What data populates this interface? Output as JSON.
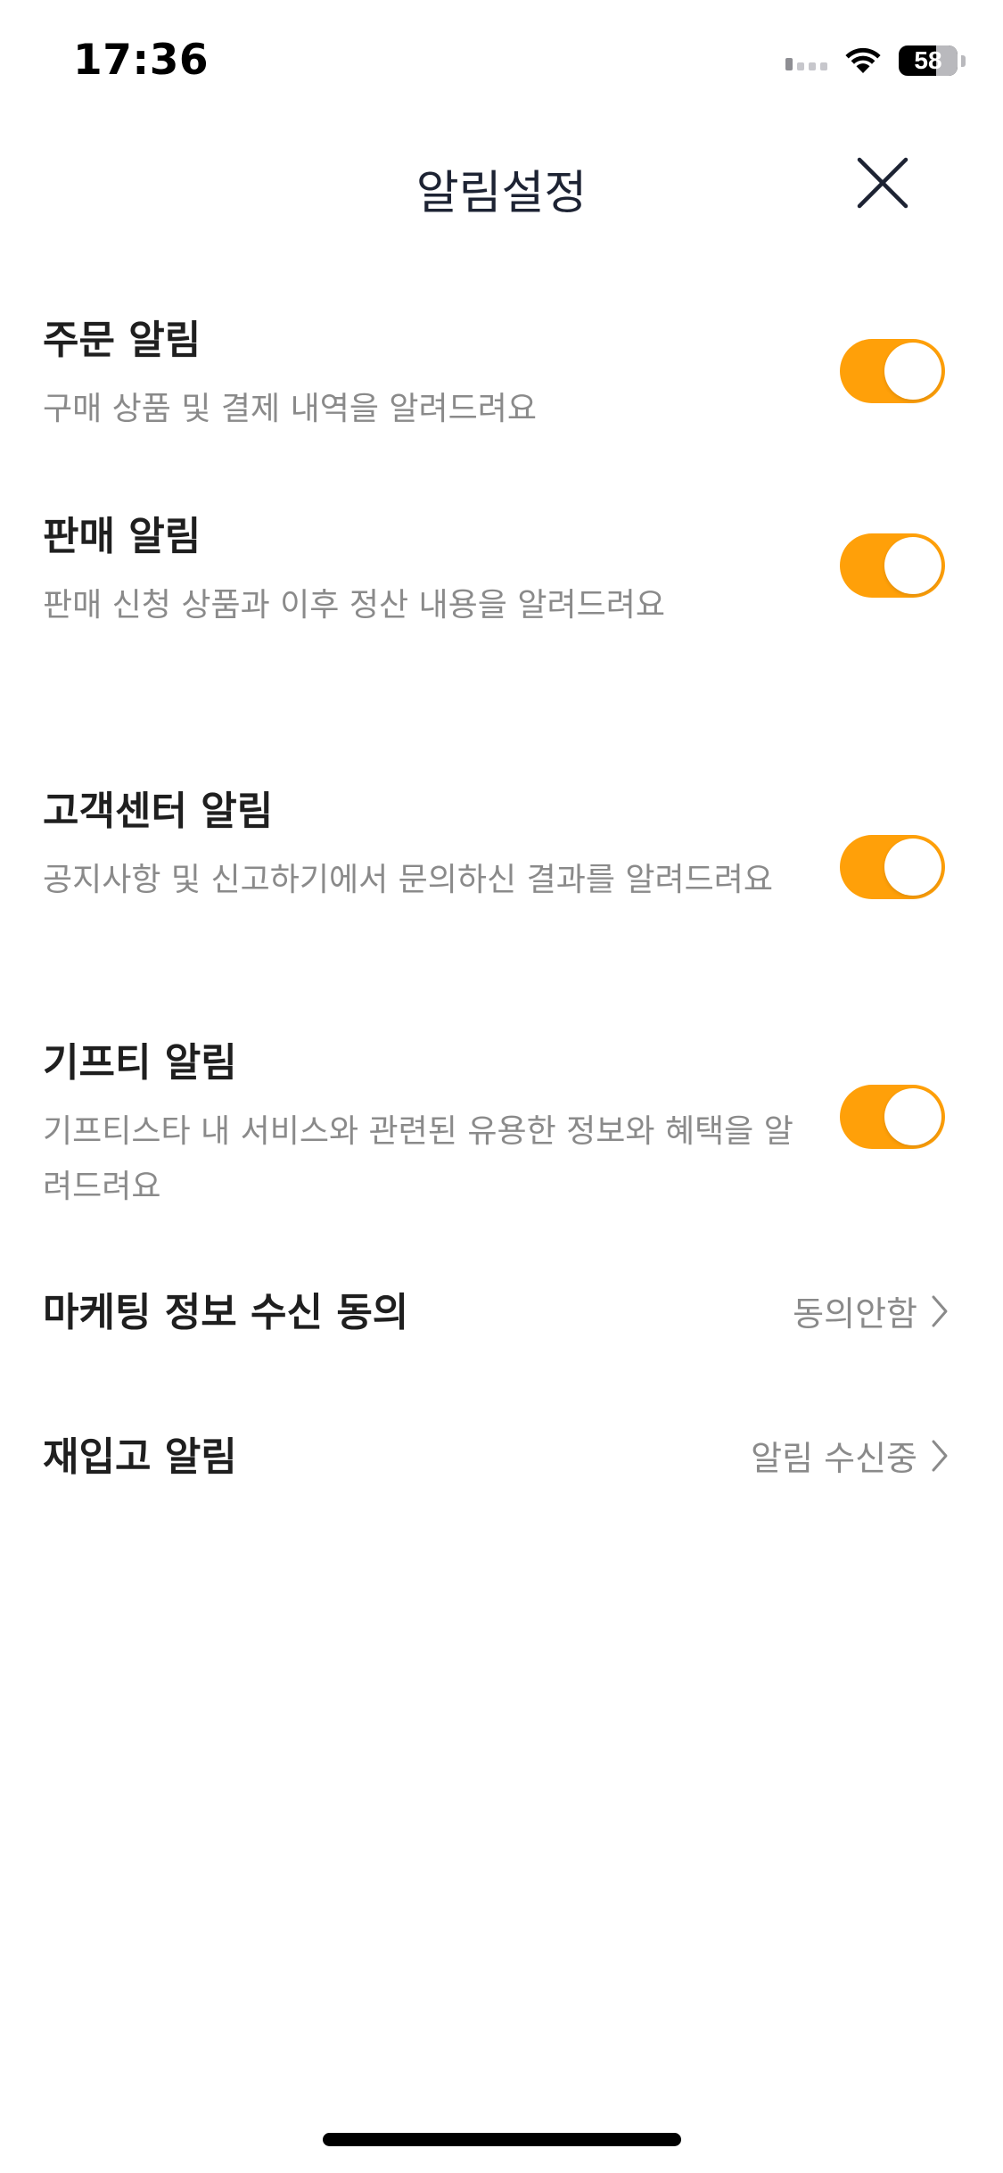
{
  "status_bar": {
    "time": "17:36",
    "battery": "58"
  },
  "header": {
    "title": "알림설정"
  },
  "settings": {
    "order": {
      "title": "주문 알림",
      "description": "구매 상품 및 결제 내역을 알려드려요",
      "enabled": true
    },
    "sale": {
      "title": "판매 알림",
      "description": "판매 신청 상품과 이후 정산 내용을 알려드려요",
      "enabled": true
    },
    "support": {
      "title": "고객센터 알림",
      "description": "공지사항 및 신고하기에서 문의하신 결과를 알려드려요",
      "enabled": true
    },
    "giftistar": {
      "title": "기프티 알림",
      "description": "기프티스타 내 서비스와 관련된 유용한 정보와 혜택을 알려드려요",
      "enabled": true
    },
    "marketing": {
      "title": "마케팅 정보 수신 동의",
      "value": "동의안함"
    },
    "restock": {
      "title": "재입고 알림",
      "value": "알림 수신중"
    }
  },
  "colors": {
    "toggle_on": "#ffa009",
    "title_text": "#1f1f1f",
    "secondary_text": "#8a8a8a"
  }
}
